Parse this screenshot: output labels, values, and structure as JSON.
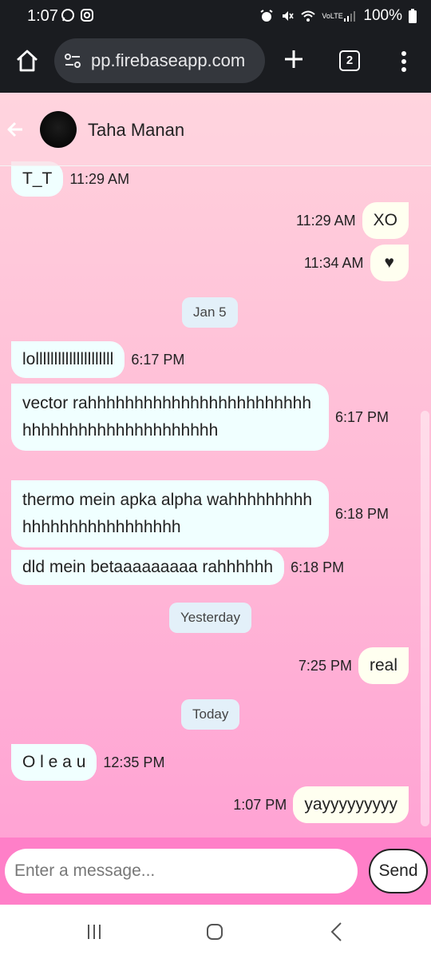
{
  "status": {
    "time": "1:07",
    "battery": "100%",
    "volte": "VoLTE"
  },
  "browser": {
    "url": "pp.firebaseapp.com",
    "tab_count": "2"
  },
  "chat": {
    "contact_name": "Taha Manan",
    "messages": [
      {
        "dir": "in",
        "text": "T_T",
        "time": "11:29 AM"
      },
      {
        "dir": "out",
        "text": "XO",
        "time": "11:29 AM"
      },
      {
        "dir": "out",
        "text": "♥",
        "time": "11:34 AM"
      },
      {
        "dir": "in",
        "text": "lolllllllllllllllllllll",
        "time": "6:17 PM"
      },
      {
        "dir": "in",
        "text": "vector rahhhhhhhhhhhhhhhhhhhhhhhhhhhhhhhhhhhhhhhhhhhhh",
        "time": "6:17 PM"
      },
      {
        "dir": "in",
        "text": "thermo mein apka alpha wahhhhhhhhhhhhhhhhhhhhhhhhhh",
        "time": "6:18 PM"
      },
      {
        "dir": "in",
        "text": "dld mein betaaaaaaaaa rahhhhhh",
        "time": "6:18 PM"
      },
      {
        "dir": "out",
        "text": "real",
        "time": "7:25 PM"
      },
      {
        "dir": "in",
        "text": "O l e a u",
        "time": "12:35 PM"
      },
      {
        "dir": "out",
        "text": "yayyyyyyyyy",
        "time": "1:07 PM"
      }
    ],
    "dates": [
      "Jan 5",
      "Yesterday",
      "Today"
    ]
  },
  "composer": {
    "placeholder": "Enter a message...",
    "send_label": "Send"
  },
  "colors": {
    "incoming_bubble": "#f0ffff",
    "outgoing_bubble": "#fffff0",
    "composer_bar": "#ff7fc8",
    "chat_bg_top": "#ffd1dc",
    "chat_bg_bottom": "#ffa3d4"
  },
  "icons": [
    "whatsapp-icon",
    "instagram-icon",
    "alarm-icon",
    "mute-icon",
    "wifi-icon",
    "signal-icon",
    "battery-icon",
    "home-icon",
    "site-settings-icon",
    "plus-icon",
    "tabs-icon",
    "menu-icon",
    "back-arrow-icon",
    "recents-icon",
    "nav-home-icon",
    "nav-back-icon"
  ]
}
